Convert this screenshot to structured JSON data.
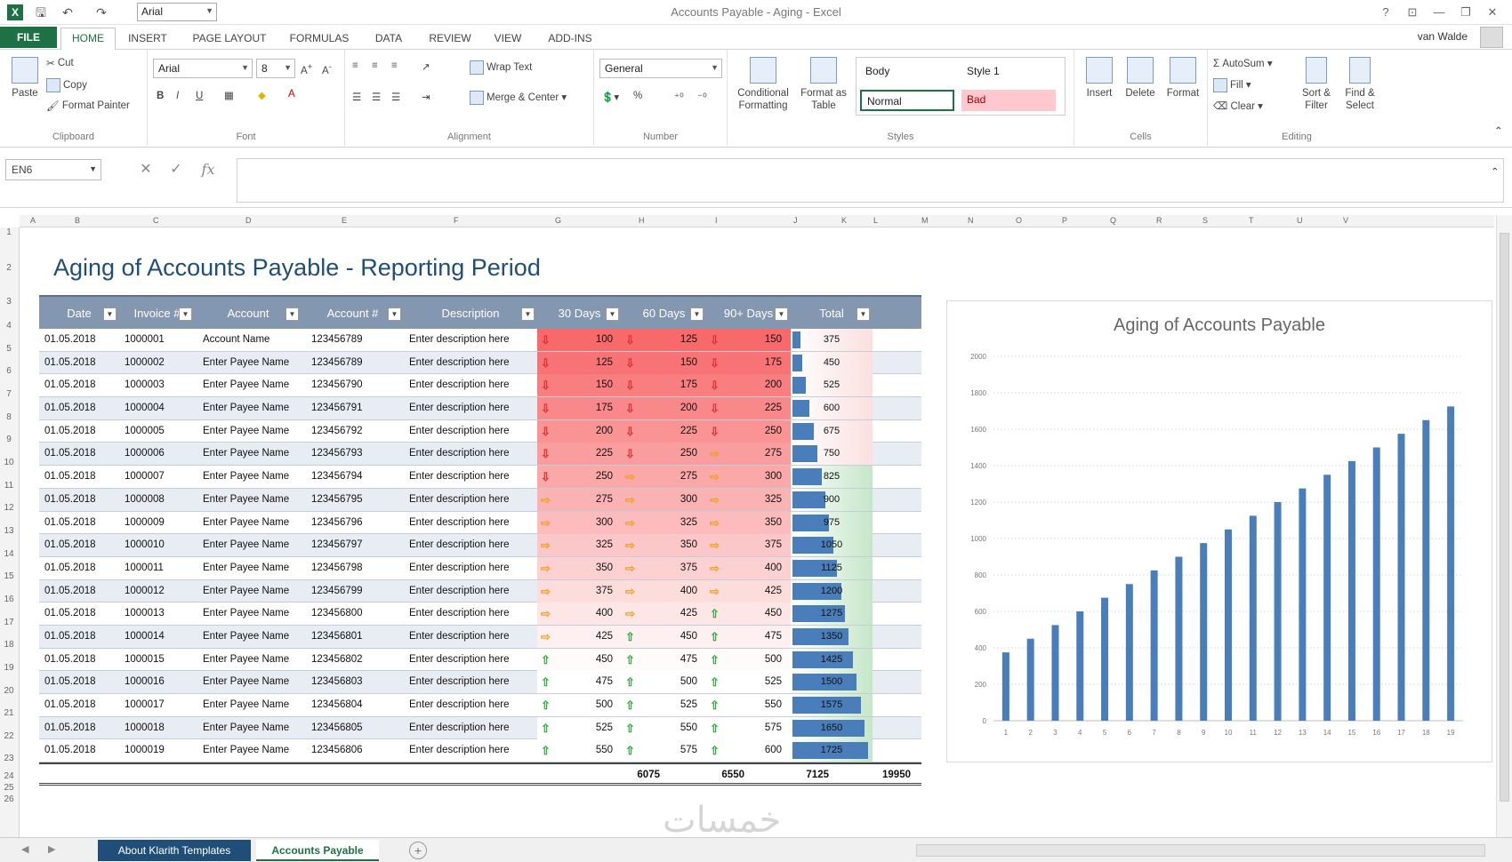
{
  "titlebar": {
    "app_icon": "X",
    "font_box": "Arial",
    "window_title": "Accounts Payable - Aging - Excel",
    "help": "?",
    "ribbon_opts": "⊡",
    "minimize": "—",
    "restore": "❐",
    "close": "✕",
    "icons": [
      "excel-icon",
      "save-icon",
      "undo-icon",
      "redo-icon"
    ]
  },
  "ribbon_tabs": {
    "file": "FILE",
    "tabs": [
      "HOME",
      "INSERT",
      "PAGE LAYOUT",
      "FORMULAS",
      "DATA",
      "REVIEW",
      "VIEW",
      "ADD-INS"
    ],
    "user": "van Walde"
  },
  "clipboard": {
    "paste": "Paste",
    "cut": "Cut",
    "copy": "Copy",
    "format_painter": "Format Painter",
    "label": "Clipboard"
  },
  "font": {
    "name": "Arial",
    "size": "8",
    "bold": "B",
    "italic": "I",
    "underline": "U",
    "label": "Font"
  },
  "alignment": {
    "wrap": "Wrap Text",
    "merge": "Merge & Center",
    "label": "Alignment"
  },
  "number": {
    "format": "General",
    "percent": "%",
    "label": "Number"
  },
  "styles": {
    "conditional": "Conditional Formatting",
    "format_table": "Format as Table",
    "body": "Body",
    "style1": "Style 1",
    "normal": "Normal",
    "bad": "Bad",
    "label": "Styles"
  },
  "cells": {
    "insert": "Insert",
    "delete": "Delete",
    "format": "Format",
    "label": "Cells"
  },
  "editing": {
    "autosum": "AutoSum",
    "fill": "Fill",
    "clear": "Clear",
    "sort": "Sort & Filter",
    "find": "Find & Select",
    "label": "Editing"
  },
  "formula_bar": {
    "namebox": "EN6",
    "cancel": "✕",
    "enter": "✓",
    "fx": "fx",
    "value": ""
  },
  "columns": [
    "A",
    "B",
    "C",
    "D",
    "E",
    "F",
    "G",
    "H",
    "I",
    "J",
    "K",
    "L",
    "M",
    "N",
    "O",
    "P",
    "Q",
    "R",
    "S",
    "T",
    "U",
    "V"
  ],
  "rows": [
    "1",
    "2",
    "3",
    "4",
    "5",
    "6",
    "7",
    "8",
    "9",
    "10",
    "11",
    "12",
    "13",
    "14",
    "15",
    "16",
    "17",
    "18",
    "19",
    "20",
    "21",
    "22",
    "23",
    "24",
    "25",
    "26"
  ],
  "page_title": "Aging of Accounts Payable - Reporting Period",
  "table": {
    "headers": [
      "Date",
      "Invoice #",
      "Account",
      "Account #",
      "Description",
      "30 Days",
      "60 Days",
      "90+ Days",
      "Total"
    ],
    "rows": [
      {
        "date": "01.05.2018",
        "invoice": "1000001",
        "account": "Account Name",
        "acctno": "123456789",
        "desc": "Enter description here",
        "d30": "100",
        "d60": "125",
        "d90": "150",
        "total": "375",
        "a30": "down",
        "a60": "down",
        "a90": "down",
        "frac": 0.1
      },
      {
        "date": "01.05.2018",
        "invoice": "1000002",
        "account": "Enter Payee Name",
        "acctno": "123456789",
        "desc": "Enter description here",
        "d30": "125",
        "d60": "150",
        "d90": "175",
        "total": "450",
        "a30": "down",
        "a60": "down",
        "a90": "down",
        "frac": 0.13
      },
      {
        "date": "01.05.2018",
        "invoice": "1000003",
        "account": "Enter Payee Name",
        "acctno": "123456790",
        "desc": "Enter description here",
        "d30": "150",
        "d60": "175",
        "d90": "200",
        "total": "525",
        "a30": "down",
        "a60": "down",
        "a90": "down",
        "frac": 0.17
      },
      {
        "date": "01.05.2018",
        "invoice": "1000004",
        "account": "Enter Payee Name",
        "acctno": "123456791",
        "desc": "Enter description here",
        "d30": "175",
        "d60": "200",
        "d90": "225",
        "total": "600",
        "a30": "down",
        "a60": "down",
        "a90": "down",
        "frac": 0.22
      },
      {
        "date": "01.05.2018",
        "invoice": "1000005",
        "account": "Enter Payee Name",
        "acctno": "123456792",
        "desc": "Enter description here",
        "d30": "200",
        "d60": "225",
        "d90": "250",
        "total": "675",
        "a30": "down",
        "a60": "down",
        "a90": "down",
        "frac": 0.27
      },
      {
        "date": "01.05.2018",
        "invoice": "1000006",
        "account": "Enter Payee Name",
        "acctno": "123456793",
        "desc": "Enter description here",
        "d30": "225",
        "d60": "250",
        "d90": "275",
        "total": "750",
        "a30": "down",
        "a60": "down",
        "a90": "side",
        "frac": 0.32
      },
      {
        "date": "01.05.2018",
        "invoice": "1000007",
        "account": "Enter Payee Name",
        "acctno": "123456794",
        "desc": "Enter description here",
        "d30": "250",
        "d60": "275",
        "d90": "300",
        "total": "825",
        "a30": "down",
        "a60": "side",
        "a90": "side",
        "frac": 0.37
      },
      {
        "date": "01.05.2018",
        "invoice": "1000008",
        "account": "Enter Payee Name",
        "acctno": "123456795",
        "desc": "Enter description here",
        "d30": "275",
        "d60": "300",
        "d90": "325",
        "total": "900",
        "a30": "side",
        "a60": "side",
        "a90": "side",
        "frac": 0.42
      },
      {
        "date": "01.05.2018",
        "invoice": "1000009",
        "account": "Enter Payee Name",
        "acctno": "123456796",
        "desc": "Enter description here",
        "d30": "300",
        "d60": "325",
        "d90": "350",
        "total": "975",
        "a30": "side",
        "a60": "side",
        "a90": "side",
        "frac": 0.47
      },
      {
        "date": "01.05.2018",
        "invoice": "1000010",
        "account": "Enter Payee Name",
        "acctno": "123456797",
        "desc": "Enter description here",
        "d30": "325",
        "d60": "350",
        "d90": "375",
        "total": "1050",
        "a30": "side",
        "a60": "side",
        "a90": "side",
        "frac": 0.52
      },
      {
        "date": "01.05.2018",
        "invoice": "1000011",
        "account": "Enter Payee Name",
        "acctno": "123456798",
        "desc": "Enter description here",
        "d30": "350",
        "d60": "375",
        "d90": "400",
        "total": "1125",
        "a30": "side",
        "a60": "side",
        "a90": "side",
        "frac": 0.57
      },
      {
        "date": "01.05.2018",
        "invoice": "1000012",
        "account": "Enter Payee Name",
        "acctno": "123456799",
        "desc": "Enter description here",
        "d30": "375",
        "d60": "400",
        "d90": "425",
        "total": "1200",
        "a30": "side",
        "a60": "side",
        "a90": "side",
        "frac": 0.62
      },
      {
        "date": "01.05.2018",
        "invoice": "1000013",
        "account": "Enter Payee Name",
        "acctno": "123456800",
        "desc": "Enter description here",
        "d30": "400",
        "d60": "425",
        "d90": "450",
        "total": "1275",
        "a30": "side",
        "a60": "side",
        "a90": "up",
        "frac": 0.67
      },
      {
        "date": "01.05.2018",
        "invoice": "1000014",
        "account": "Enter Payee Name",
        "acctno": "123456801",
        "desc": "Enter description here",
        "d30": "425",
        "d60": "450",
        "d90": "475",
        "total": "1350",
        "a30": "side",
        "a60": "up",
        "a90": "up",
        "frac": 0.72
      },
      {
        "date": "01.05.2018",
        "invoice": "1000015",
        "account": "Enter Payee Name",
        "acctno": "123456802",
        "desc": "Enter description here",
        "d30": "450",
        "d60": "475",
        "d90": "500",
        "total": "1425",
        "a30": "up",
        "a60": "up",
        "a90": "up",
        "frac": 0.77
      },
      {
        "date": "01.05.2018",
        "invoice": "1000016",
        "account": "Enter Payee Name",
        "acctno": "123456803",
        "desc": "Enter description here",
        "d30": "475",
        "d60": "500",
        "d90": "525",
        "total": "1500",
        "a30": "up",
        "a60": "up",
        "a90": "up",
        "frac": 0.82
      },
      {
        "date": "01.05.2018",
        "invoice": "1000017",
        "account": "Enter Payee Name",
        "acctno": "123456804",
        "desc": "Enter description here",
        "d30": "500",
        "d60": "525",
        "d90": "550",
        "total": "1575",
        "a30": "up",
        "a60": "up",
        "a90": "up",
        "frac": 0.87
      },
      {
        "date": "01.05.2018",
        "invoice": "1000018",
        "account": "Enter Payee Name",
        "acctno": "123456805",
        "desc": "Enter description here",
        "d30": "525",
        "d60": "550",
        "d90": "575",
        "total": "1650",
        "a30": "up",
        "a60": "up",
        "a90": "up",
        "frac": 0.92
      },
      {
        "date": "01.05.2018",
        "invoice": "1000019",
        "account": "Enter Payee Name",
        "acctno": "123456806",
        "desc": "Enter description here",
        "d30": "550",
        "d60": "575",
        "d90": "600",
        "total": "1725",
        "a30": "up",
        "a60": "up",
        "a90": "up",
        "frac": 0.97
      }
    ],
    "totals": {
      "d30": "6075",
      "d60": "6550",
      "d90": "7125",
      "total": "19950"
    }
  },
  "chart_data": {
    "type": "bar",
    "title": "Aging of Accounts Payable",
    "categories": [
      "1",
      "2",
      "3",
      "4",
      "5",
      "6",
      "7",
      "8",
      "9",
      "10",
      "11",
      "12",
      "13",
      "14",
      "15",
      "16",
      "17",
      "18",
      "19"
    ],
    "values": [
      375,
      450,
      525,
      600,
      675,
      750,
      825,
      900,
      975,
      1050,
      1125,
      1200,
      1275,
      1350,
      1425,
      1500,
      1575,
      1650,
      1725
    ],
    "yticks": [
      0,
      200,
      400,
      600,
      800,
      1000,
      1200,
      1400,
      1600,
      1800,
      2000
    ],
    "ylim": [
      0,
      2000
    ],
    "grid": true,
    "color": "#4a7ebb"
  },
  "sheet_tabs": {
    "tab1": "About Klarith Templates",
    "tab2": "Accounts Payable",
    "add": "+",
    "prev": "◀",
    "next": "▶"
  },
  "watermark": "خمسات",
  "colors": {
    "excel_green": "#1e7145",
    "header_blue": "#8497b0",
    "title_blue": "#1f4e79",
    "bar_blue": "#4a7ebb",
    "heat_red": "#f8696b",
    "heat_green": "#63be7b"
  }
}
